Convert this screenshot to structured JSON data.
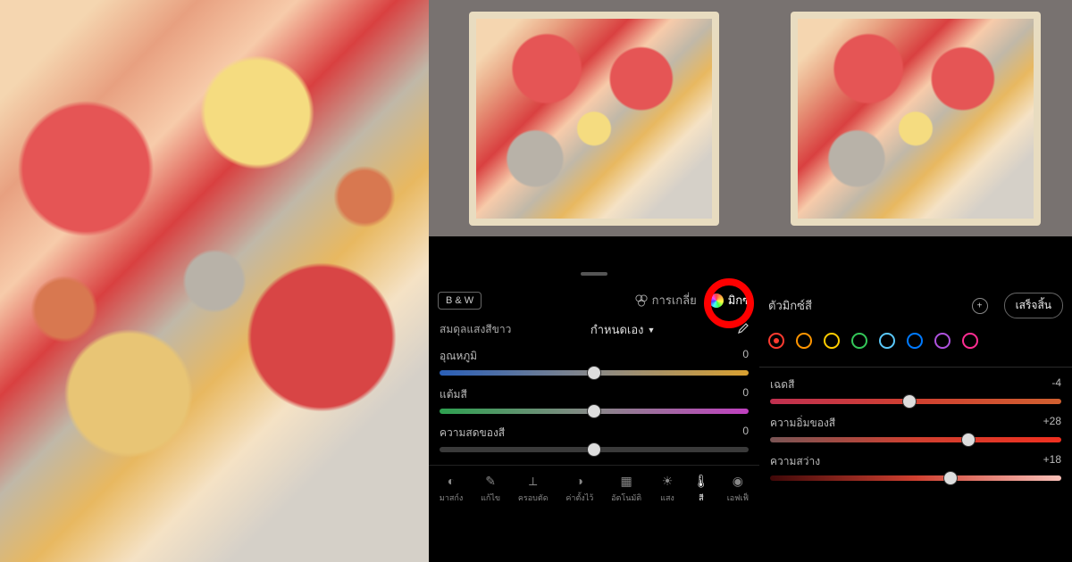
{
  "tabs": {
    "bw": "B & W",
    "grading": "การเกลี่ย",
    "mix": "มิกซ์"
  },
  "wb": {
    "label": "สมดุลแสงสีขาว",
    "value": "กำหนดเอง"
  },
  "sliders_mid": {
    "temp": {
      "label": "อุณหภูมิ",
      "value": "0",
      "pos": 50
    },
    "tint": {
      "label": "แต้มสี",
      "value": "0",
      "pos": 50
    },
    "vibrance": {
      "label": "ความสดของสี",
      "value": "0",
      "pos": 50
    }
  },
  "toolbar": {
    "masking": "มาสก์ง",
    "heal": "แก้ไข",
    "crop": "ครอบตัด",
    "presets": "ค่าตั้งไว้",
    "auto": "อัตโนมัติ",
    "light": "แสง",
    "color": "สี",
    "effects": "เอฟเฟ็"
  },
  "mixer": {
    "title": "ตัวมิกซ์สี",
    "done": "เสร็จสิ้น",
    "colors": [
      "#ff3b30",
      "#ff9500",
      "#ffcc00",
      "#34c759",
      "#5ac8fa",
      "#007aff",
      "#af52de",
      "#ff2d92"
    ],
    "selected": 0,
    "hue": {
      "label": "เฉดสี",
      "value": "-4",
      "pos": 48
    },
    "sat": {
      "label": "ความอิ่มของสี",
      "value": "+28",
      "pos": 68
    },
    "lum": {
      "label": "ความสว่าง",
      "value": "+18",
      "pos": 62
    }
  }
}
